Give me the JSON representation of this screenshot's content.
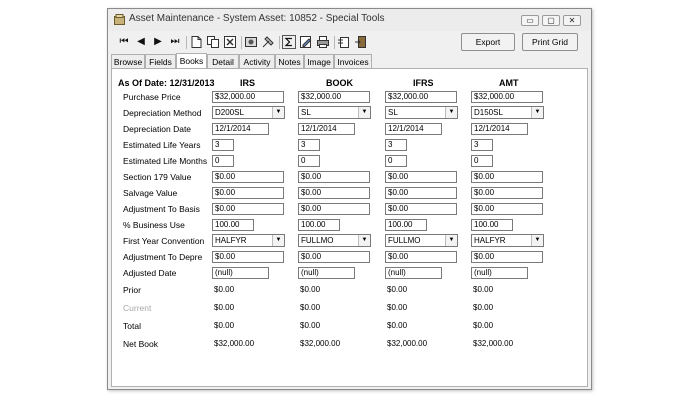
{
  "window": {
    "title": "Asset Maintenance - System Asset: 10852 - Special Tools",
    "minimize": "▭",
    "maximize": "▢",
    "close": "✕"
  },
  "toolbar": {
    "first": "⏮",
    "prev": "◀",
    "next": "▶",
    "last": "⏭",
    "export_label": "Export",
    "print_grid_label": "Print Grid"
  },
  "tabs": [
    {
      "label": "Browse"
    },
    {
      "label": "Fields"
    },
    {
      "label": "Books"
    },
    {
      "label": "Detail"
    },
    {
      "label": "Activity"
    },
    {
      "label": "Notes"
    },
    {
      "label": "Image"
    },
    {
      "label": "Invoices"
    }
  ],
  "header": {
    "as_of_date": "As Of Date: 12/31/2013",
    "books": [
      "IRS",
      "BOOK",
      "IFRS",
      "AMT"
    ]
  },
  "rows": [
    {
      "label": "Purchase Price",
      "values": [
        "$32,000.00",
        "$32,000.00",
        "$32,000.00",
        "$32,000.00"
      ]
    },
    {
      "label": "Depreciation Method",
      "values": [
        "D200SL",
        "SL",
        "SL",
        "D150SL"
      ]
    },
    {
      "label": "Depreciation Date",
      "values": [
        "12/1/2014",
        "12/1/2014",
        "12/1/2014",
        "12/1/2014"
      ]
    },
    {
      "label": "Estimated Life Years",
      "values": [
        "3",
        "3",
        "3",
        "3"
      ]
    },
    {
      "label": "Estimated Life Months",
      "values": [
        "0",
        "0",
        "0",
        "0"
      ]
    },
    {
      "label": "Section 179 Value",
      "values": [
        "$0.00",
        "$0.00",
        "$0.00",
        "$0.00"
      ]
    },
    {
      "label": "Salvage Value",
      "values": [
        "$0.00",
        "$0.00",
        "$0.00",
        "$0.00"
      ]
    },
    {
      "label": "Adjustment To Basis",
      "values": [
        "$0.00",
        "$0.00",
        "$0.00",
        "$0.00"
      ]
    },
    {
      "label": "% Business Use",
      "values": [
        "100.00",
        "100.00",
        "100.00",
        "100.00"
      ]
    },
    {
      "label": "First Year Convention",
      "values": [
        "HALFYR",
        "FULLMO",
        "FULLMO",
        "HALFYR"
      ]
    },
    {
      "label": "Adjustment To Depre",
      "values": [
        "$0.00",
        "$0.00",
        "$0.00",
        "$0.00"
      ]
    },
    {
      "label": "Adjusted Date",
      "values": [
        "(null)",
        "(null)",
        "(null)",
        "(null)"
      ]
    },
    {
      "label": "Prior",
      "values": [
        "$0.00",
        "$0.00",
        "$0.00",
        "$0.00"
      ]
    },
    {
      "label": "Current",
      "values": [
        "$0.00",
        "$0.00",
        "$0.00",
        "$0.00"
      ]
    },
    {
      "label": "Total",
      "values": [
        "$0.00",
        "$0.00",
        "$0.00",
        "$0.00"
      ]
    },
    {
      "label": "Net Book",
      "values": [
        "$32,000.00",
        "$32,000.00",
        "$32,000.00",
        "$32,000.00"
      ]
    }
  ],
  "icons": {
    "new": "new-document-icon",
    "copy": "copy-icon",
    "delete": "delete-icon",
    "tools1": "tools-icon",
    "tools2": "settings-icon",
    "sum": "sum-icon",
    "edit": "edit-icon",
    "print": "print-icon",
    "attach": "attach-icon",
    "exit": "exit-door-icon"
  }
}
